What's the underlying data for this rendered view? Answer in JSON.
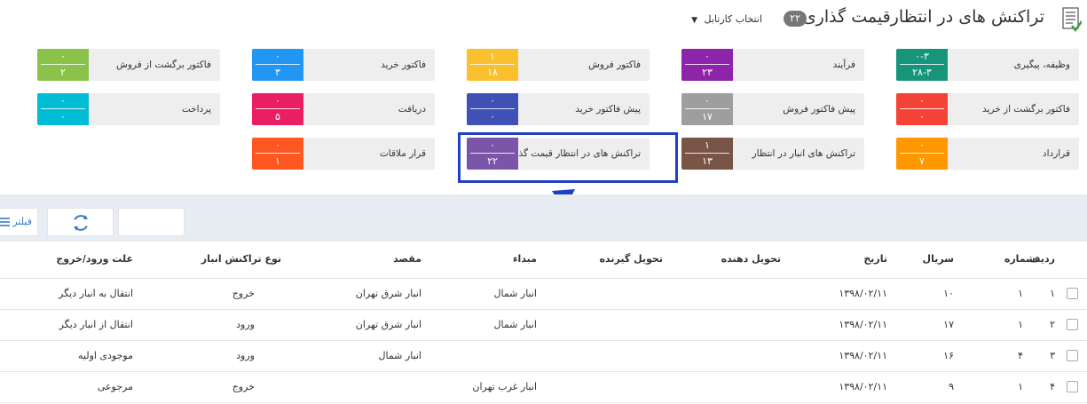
{
  "header": {
    "title": "تراکنش های در انتظارقیمت گذاری",
    "count": "۲۲",
    "cartable_label": "انتخاب کارتابل"
  },
  "tiles": [
    {
      "label": "وظیفه، پیگیری",
      "top": "۰-۳",
      "bottom": "۲۸-۳",
      "color": "#16957a"
    },
    {
      "label": "فرآیند",
      "top": "۰",
      "bottom": "۲۳",
      "color": "#8e24aa"
    },
    {
      "label": "فاکتور فروش",
      "top": "۱",
      "bottom": "۱۸",
      "color": "#fbc02d"
    },
    {
      "label": "فاکتور خرید",
      "top": "۰",
      "bottom": "۳",
      "color": "#2196f3"
    },
    {
      "label": "فاکتور برگشت از فروش",
      "top": "۰",
      "bottom": "۲",
      "color": "#8bc34a"
    },
    {
      "label": "فاکتور برگشت از خرید",
      "top": "۰",
      "bottom": "۰",
      "color": "#f44336"
    },
    {
      "label": "پیش فاکتور فروش",
      "top": "۰",
      "bottom": "۱۷",
      "color": "#9e9e9e"
    },
    {
      "label": "پیش فاکتور خرید",
      "top": "۰",
      "bottom": "۰",
      "color": "#3f51b5"
    },
    {
      "label": "دریافت",
      "top": "۰",
      "bottom": "۵",
      "color": "#e91e63"
    },
    {
      "label": "پرداخت",
      "top": "۰",
      "bottom": "۰",
      "color": "#00bcd4"
    },
    {
      "label": "قرارداد",
      "top": "۰",
      "bottom": "۷",
      "color": "#ff9800"
    },
    {
      "label": "تراکنش های انبار در انتظار",
      "top": "۱",
      "bottom": "۱۳",
      "color": "#795548"
    },
    {
      "label": "تراکنش های در انتظار قیمت گذاری",
      "top": "۰",
      "bottom": "۲۲",
      "color": "#7b55a8"
    },
    {
      "label": "قرار ملاقات",
      "top": "۰",
      "bottom": "۱",
      "color": "#ff5722"
    }
  ],
  "toolbar": {
    "filter_label": "فیلتر"
  },
  "table": {
    "columns": [
      "ردیف",
      "شماره",
      "سریال",
      "تاریخ",
      "تحویل دهنده",
      "تحویل گیرنده",
      "مبداء",
      "مقصد",
      "نوع تراکنش انبار",
      "علت ورود/خروج"
    ],
    "rows": [
      [
        "۱",
        "۱",
        "۱۰",
        "۱۳۹۸/۰۲/۱۱",
        "",
        "",
        "انبار شمال",
        "انبار شرق تهران",
        "خروج",
        "انتقال به انبار دیگر"
      ],
      [
        "۲",
        "۱",
        "۱۷",
        "۱۳۹۸/۰۲/۱۱",
        "",
        "",
        "انبار شمال",
        "انبار شرق تهران",
        "ورود",
        "انتقال از انبار دیگر"
      ],
      [
        "۳",
        "۴",
        "۱۶",
        "۱۳۹۸/۰۲/۱۱",
        "",
        "",
        "",
        "انبار شمال",
        "ورود",
        "موجودی اولیه"
      ],
      [
        "۴",
        "۱",
        "۹",
        "۱۳۹۸/۰۲/۱۱",
        "",
        "",
        "انبار غرب تهران",
        "",
        "خروج",
        "مرجوعی"
      ]
    ]
  }
}
